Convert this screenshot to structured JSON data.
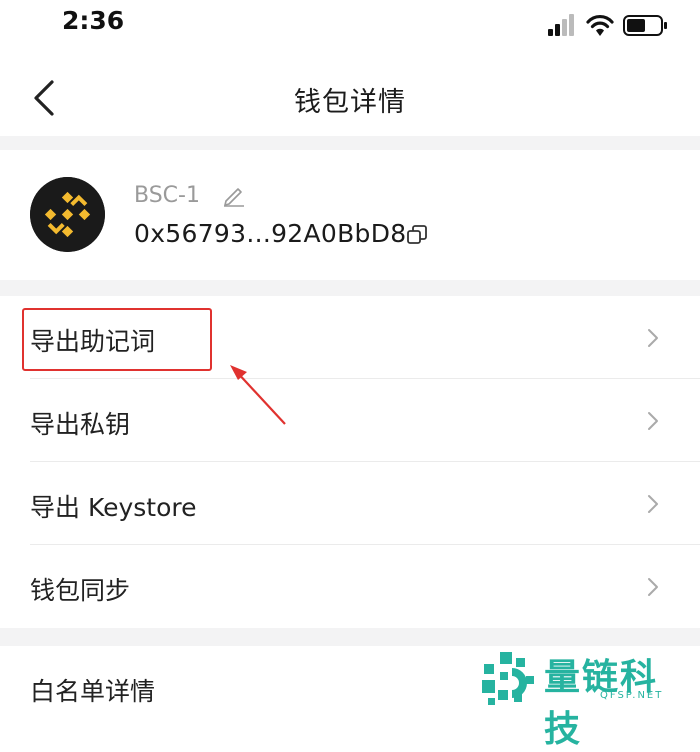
{
  "status": {
    "time": "2:36"
  },
  "nav": {
    "title": "钱包详情"
  },
  "wallet": {
    "name": "BSC-1",
    "address": "0x56793...92A0BbD8",
    "avatar_icon": "binance-logo-icon",
    "avatar_color": "#F3BA2F"
  },
  "menu": {
    "items": [
      {
        "label": "导出助记词"
      },
      {
        "label": "导出私钥"
      },
      {
        "label": "导出 Keystore"
      },
      {
        "label": "钱包同步"
      }
    ]
  },
  "whitelist": {
    "label": "白名单详情"
  },
  "watermark": {
    "text": "量链科技",
    "sub": "QFSP.NET",
    "color": "#26B3A0"
  },
  "colors": {
    "highlight": "#E0322F",
    "accent": "#F3BA2F"
  }
}
